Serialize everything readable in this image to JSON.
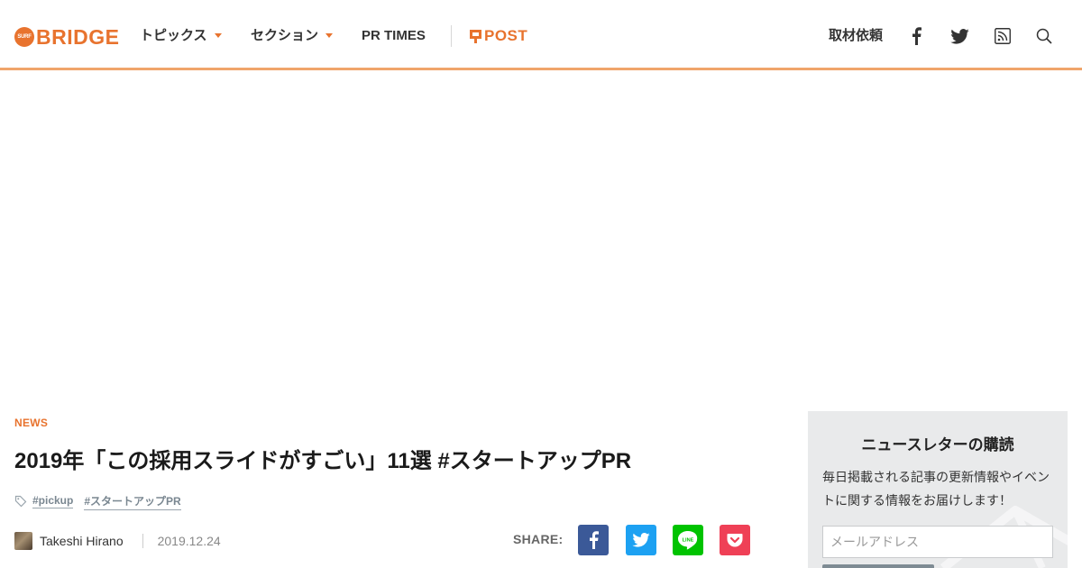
{
  "header": {
    "logo_text": "BRIDGE",
    "logo_mark_text": "SURF",
    "nav": [
      {
        "label": "トピックス",
        "has_dropdown": true
      },
      {
        "label": "セクション",
        "has_dropdown": true
      },
      {
        "label": "PR TIMES",
        "has_dropdown": false
      }
    ],
    "post_label": "POST",
    "request_label": "取材依頼",
    "icons": [
      "facebook-icon",
      "twitter-icon",
      "rss-icon",
      "search-icon"
    ]
  },
  "article": {
    "category": "NEWS",
    "title": "2019年「この採用スライドがすごい」11選 #スタートアップPR",
    "tags": [
      "#pickup",
      "#スタートアップPR"
    ],
    "author": "Takeshi Hirano",
    "date": "2019.12.24",
    "share_label": "SHARE:",
    "share_buttons": [
      {
        "name": "facebook",
        "color": "#3b5998"
      },
      {
        "name": "twitter",
        "color": "#1da1f2"
      },
      {
        "name": "line",
        "color": "#00c300"
      },
      {
        "name": "pocket",
        "color": "#ef4056"
      }
    ]
  },
  "newsletter": {
    "title": "ニュースレターの購読",
    "description": "毎日掲載される記事の更新情報やイベントに関する情報をお届けします！",
    "email_placeholder": "メールアドレス"
  },
  "colors": {
    "accent": "#e8732e",
    "header_border": "#f0a56b",
    "tag": "#7a8791",
    "sidebar_bg": "#e9eaeb"
  }
}
